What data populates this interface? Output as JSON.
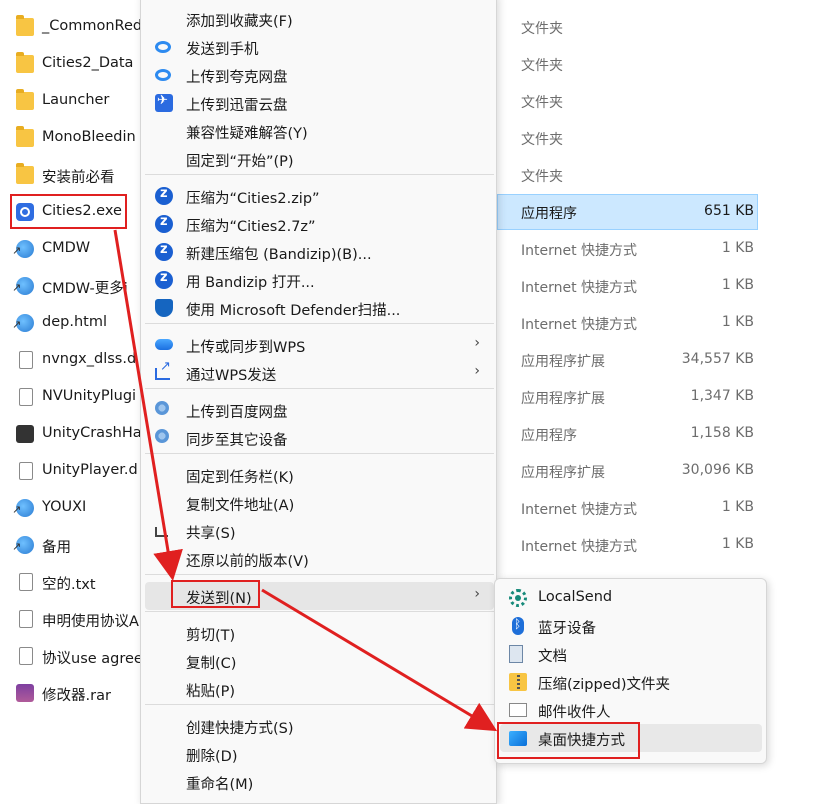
{
  "files": [
    {
      "name": "_CommonRed",
      "type": "文件夹",
      "size": "",
      "icon": "folder-icon"
    },
    {
      "name": "Cities2_Data",
      "type": "文件夹",
      "size": "",
      "icon": "folder-icon"
    },
    {
      "name": "Launcher",
      "type": "文件夹",
      "size": "",
      "icon": "folder-icon"
    },
    {
      "name": "MonoBleedin",
      "type": "文件夹",
      "size": "",
      "icon": "folder-icon"
    },
    {
      "name": "安装前必看",
      "type": "文件夹",
      "size": "",
      "icon": "folder-icon"
    },
    {
      "name": "Cities2.exe",
      "type": "应用程序",
      "size": "651 KB",
      "icon": "exe-icon"
    },
    {
      "name": "CMDW",
      "type": "Internet 快捷方式",
      "size": "1 KB",
      "icon": "link-icon"
    },
    {
      "name": "CMDW-更多i",
      "type": "Internet 快捷方式",
      "size": "1 KB",
      "icon": "link-icon"
    },
    {
      "name": "dep.html",
      "type": "Internet 快捷方式",
      "size": "1 KB",
      "icon": "link-icon"
    },
    {
      "name": "nvngx_dlss.d",
      "type": "应用程序扩展",
      "size": "34,557 KB",
      "icon": "document-icon"
    },
    {
      "name": "NVUnityPlugi",
      "type": "应用程序扩展",
      "size": "1,347 KB",
      "icon": "document-icon"
    },
    {
      "name": "UnityCrashHa",
      "type": "应用程序",
      "size": "1,158 KB",
      "icon": "unity-icon"
    },
    {
      "name": "UnityPlayer.d",
      "type": "应用程序扩展",
      "size": "30,096 KB",
      "icon": "document-icon"
    },
    {
      "name": "YOUXI",
      "type": "Internet 快捷方式",
      "size": "1 KB",
      "icon": "link-icon"
    },
    {
      "name": "备用",
      "type": "Internet 快捷方式",
      "size": "1 KB",
      "icon": "link-icon"
    },
    {
      "name": "空的.txt",
      "type": "",
      "size": "",
      "icon": "document-icon"
    },
    {
      "name": "申明使用协议A",
      "type": "",
      "size": "",
      "icon": "document-icon"
    },
    {
      "name": "协议use agree",
      "type": "",
      "size": "",
      "icon": "document-icon"
    },
    {
      "name": "修改器.rar",
      "type": "",
      "size": "",
      "icon": "rar-icon"
    }
  ],
  "menu": {
    "items": [
      {
        "label": "添加到收藏夹(F)",
        "icon": ""
      },
      {
        "label": "发送到手机",
        "icon": "cloud-icon"
      },
      {
        "label": "上传到夸克网盘",
        "icon": "cloud-icon"
      },
      {
        "label": "上传到迅雷云盘",
        "icon": "thunder-icon"
      },
      {
        "label": "兼容性疑难解答(Y)",
        "icon": ""
      },
      {
        "label": "固定到“开始”(P)",
        "icon": ""
      },
      {
        "label": "压缩为“Cities2.zip”",
        "icon": "bandizip-icon"
      },
      {
        "label": "压缩为“Cities2.7z”",
        "icon": "bandizip-icon"
      },
      {
        "label": "新建压缩包 (Bandizip)(B)...",
        "icon": "bandizip-icon"
      },
      {
        "label": "用 Bandizip 打开...",
        "icon": "bandizip-icon"
      },
      {
        "label": "使用 Microsoft Defender扫描...",
        "icon": "shield-icon"
      },
      {
        "label": "上传或同步到WPS",
        "icon": "wps-cloud-icon",
        "submenu": true
      },
      {
        "label": "通过WPS发送",
        "icon": "share-icon",
        "submenu": true
      },
      {
        "label": "上传到百度网盘",
        "icon": "baidu-icon"
      },
      {
        "label": "同步至其它设备",
        "icon": "baidu-icon"
      },
      {
        "label": "固定到任务栏(K)",
        "icon": ""
      },
      {
        "label": "复制文件地址(A)",
        "icon": ""
      },
      {
        "label": "共享(S)",
        "icon": "share-os-icon"
      },
      {
        "label": "还原以前的版本(V)",
        "icon": ""
      },
      {
        "label": "发送到(N)",
        "icon": "",
        "submenu": true
      },
      {
        "label": "剪切(T)",
        "icon": ""
      },
      {
        "label": "复制(C)",
        "icon": ""
      },
      {
        "label": "粘贴(P)",
        "icon": ""
      },
      {
        "label": "创建快捷方式(S)",
        "icon": ""
      },
      {
        "label": "删除(D)",
        "icon": ""
      },
      {
        "label": "重命名(M)",
        "icon": ""
      }
    ],
    "submenu_arrow": "›"
  },
  "sendto": {
    "items": [
      {
        "label": "LocalSend",
        "icon": "localsend-icon"
      },
      {
        "label": "蓝牙设备",
        "icon": "bluetooth-icon"
      },
      {
        "label": "文档",
        "icon": "documents-icon"
      },
      {
        "label": "压缩(zipped)文件夹",
        "icon": "zip-folder-icon"
      },
      {
        "label": "邮件收件人",
        "icon": "mail-icon"
      },
      {
        "label": "桌面快捷方式",
        "icon": "desktop-icon"
      }
    ]
  },
  "colors": {
    "annotation": "#e02020",
    "selection": "#cce8ff",
    "accent": "#2b6be0"
  }
}
